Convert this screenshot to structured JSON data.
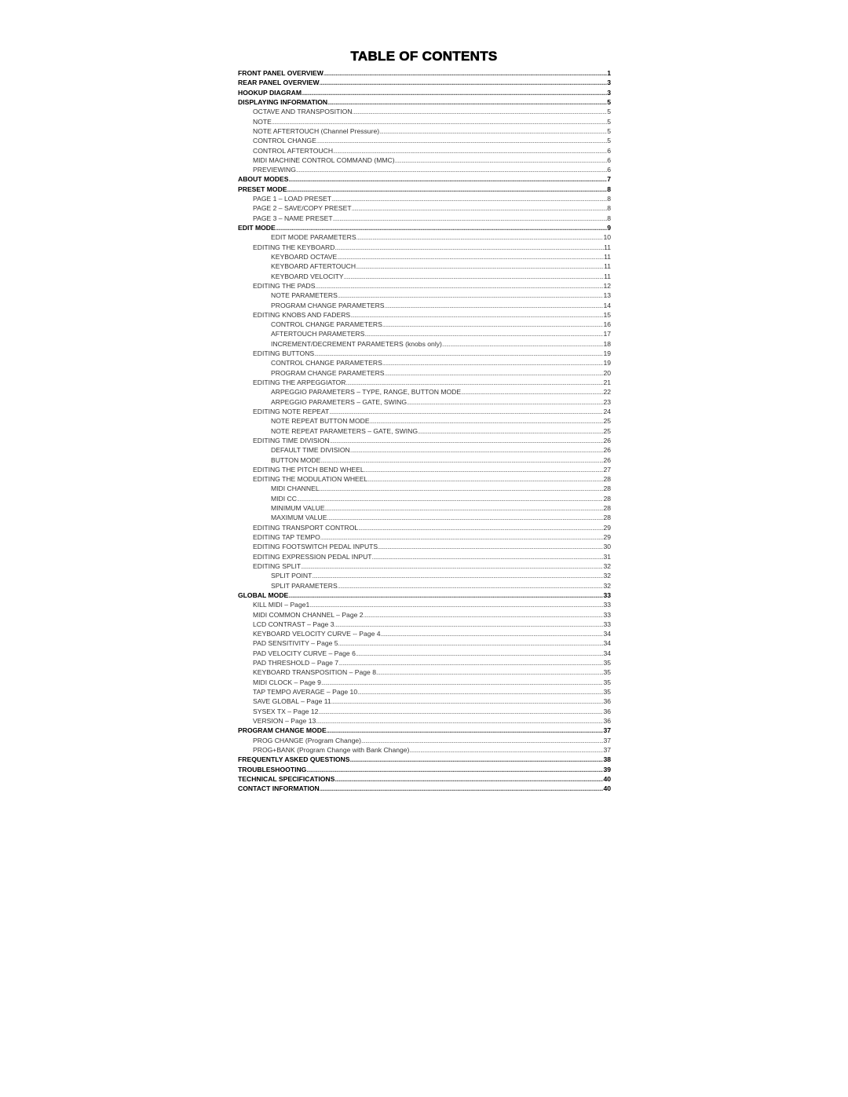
{
  "title": "TABLE OF CONTENTS",
  "entries": [
    {
      "label": "FRONT PANEL OVERVIEW",
      "page": "1",
      "level": 0
    },
    {
      "label": "REAR PANEL OVERVIEW",
      "page": "3",
      "level": 0
    },
    {
      "label": "HOOKUP DIAGRAM",
      "page": "3",
      "level": 0
    },
    {
      "label": "DISPLAYING INFORMATION",
      "page": "5",
      "level": 0
    },
    {
      "label": "OCTAVE AND TRANSPOSITION",
      "page": "5",
      "level": 1
    },
    {
      "label": "NOTE",
      "page": "5",
      "level": 1
    },
    {
      "label": "NOTE AFTERTOUCH (Channel Pressure)",
      "page": "5",
      "level": 1
    },
    {
      "label": "CONTROL CHANGE",
      "page": "5",
      "level": 1
    },
    {
      "label": "CONTROL AFTERTOUCH",
      "page": "6",
      "level": 1
    },
    {
      "label": "MIDI MACHINE CONTROL COMMAND (MMC)",
      "page": "6",
      "level": 1
    },
    {
      "label": "PREVIEWING",
      "page": "6",
      "level": 1
    },
    {
      "label": "ABOUT MODES",
      "page": "7",
      "level": 0
    },
    {
      "label": "PRESET MODE",
      "page": "8",
      "level": 0
    },
    {
      "label": "PAGE 1 – LOAD PRESET",
      "page": "8",
      "level": 1
    },
    {
      "label": "PAGE 2 – SAVE/COPY PRESET",
      "page": "8",
      "level": 1
    },
    {
      "label": "PAGE 3 – NAME PRESET",
      "page": "8",
      "level": 1
    },
    {
      "label": "EDIT MODE",
      "page": "9",
      "level": 0
    },
    {
      "label": "EDIT MODE PARAMETERS",
      "page": "10",
      "level": 2
    },
    {
      "label": "EDITING THE KEYBOARD",
      "page": "11",
      "level": 1
    },
    {
      "label": "KEYBOARD OCTAVE",
      "page": "11",
      "level": 2
    },
    {
      "label": "KEYBOARD AFTERTOUCH",
      "page": "11",
      "level": 2
    },
    {
      "label": "KEYBOARD VELOCITY",
      "page": "11",
      "level": 2
    },
    {
      "label": "EDITING THE PADS",
      "page": "12",
      "level": 1
    },
    {
      "label": "NOTE PARAMETERS",
      "page": "13",
      "level": 2
    },
    {
      "label": "PROGRAM CHANGE PARAMETERS",
      "page": "14",
      "level": 2
    },
    {
      "label": "EDITING KNOBS AND FADERS",
      "page": "15",
      "level": 1
    },
    {
      "label": "CONTROL CHANGE PARAMETERS",
      "page": "16",
      "level": 2
    },
    {
      "label": "AFTERTOUCH PARAMETERS",
      "page": "17",
      "level": 2
    },
    {
      "label": "INCREMENT/DECREMENT PARAMETERS (knobs only)",
      "page": "18",
      "level": 2
    },
    {
      "label": "EDITING BUTTONS",
      "page": "19",
      "level": 1
    },
    {
      "label": "CONTROL CHANGE PARAMETERS",
      "page": "19",
      "level": 2
    },
    {
      "label": "PROGRAM CHANGE PARAMETERS",
      "page": "20",
      "level": 2
    },
    {
      "label": "EDITING THE ARPEGGIATOR",
      "page": "21",
      "level": 1
    },
    {
      "label": "ARPEGGIO PARAMETERS – TYPE, RANGE, BUTTON MODE",
      "page": "22",
      "level": 2
    },
    {
      "label": "ARPEGGIO PARAMETERS – GATE, SWING",
      "page": "23",
      "level": 2
    },
    {
      "label": "EDITING NOTE REPEAT",
      "page": "24",
      "level": 1
    },
    {
      "label": "NOTE REPEAT BUTTON MODE",
      "page": "25",
      "level": 2
    },
    {
      "label": "NOTE REPEAT PARAMETERS – GATE, SWING",
      "page": "25",
      "level": 2
    },
    {
      "label": "EDITING TIME DIVISION",
      "page": "26",
      "level": 1
    },
    {
      "label": "DEFAULT TIME DIVISION",
      "page": "26",
      "level": 2
    },
    {
      "label": "BUTTON MODE",
      "page": "26",
      "level": 2
    },
    {
      "label": "EDITING THE PITCH BEND WHEEL",
      "page": "27",
      "level": 1
    },
    {
      "label": "EDITING THE MODULATION WHEEL",
      "page": "28",
      "level": 1
    },
    {
      "label": "MIDI CHANNEL",
      "page": "28",
      "level": 2
    },
    {
      "label": "MIDI CC",
      "page": "28",
      "level": 2
    },
    {
      "label": "MINIMUM VALUE",
      "page": "28",
      "level": 2
    },
    {
      "label": "MAXIMUM VALUE",
      "page": "28",
      "level": 2
    },
    {
      "label": "EDITING TRANSPORT CONTROL",
      "page": "29",
      "level": 1
    },
    {
      "label": "EDITING TAP TEMPO",
      "page": "29",
      "level": 1
    },
    {
      "label": "EDITING FOOTSWITCH PEDAL INPUTS",
      "page": "30",
      "level": 1
    },
    {
      "label": "EDITING EXPRESSION PEDAL INPUT",
      "page": "31",
      "level": 1
    },
    {
      "label": "EDITING SPLIT",
      "page": "32",
      "level": 1
    },
    {
      "label": "SPLIT POINT",
      "page": "32",
      "level": 2
    },
    {
      "label": "SPLIT PARAMETERS",
      "page": "32",
      "level": 2
    },
    {
      "label": "GLOBAL MODE",
      "page": "33",
      "level": 0
    },
    {
      "label": "KILL MIDI – Page1",
      "page": "33",
      "level": 1
    },
    {
      "label": "MIDI COMMON CHANNEL – Page 2",
      "page": "33",
      "level": 1
    },
    {
      "label": "LCD CONTRAST – Page 3",
      "page": "33",
      "level": 1
    },
    {
      "label": "KEYBOARD VELOCITY CURVE -- Page 4",
      "page": "34",
      "level": 1
    },
    {
      "label": "PAD SENSITIVITY – Page 5",
      "page": "34",
      "level": 1
    },
    {
      "label": "PAD VELOCITY CURVE – Page 6",
      "page": "34",
      "level": 1
    },
    {
      "label": "PAD THRESHOLD – Page 7",
      "page": "35",
      "level": 1
    },
    {
      "label": "KEYBOARD TRANSPOSITION – Page 8",
      "page": "35",
      "level": 1
    },
    {
      "label": "MIDI CLOCK – Page 9",
      "page": "35",
      "level": 1
    },
    {
      "label": "TAP TEMPO AVERAGE – Page 10",
      "page": "35",
      "level": 1
    },
    {
      "label": "SAVE GLOBAL – Page 11",
      "page": "36",
      "level": 1
    },
    {
      "label": "SYSEX TX – Page 12",
      "page": "36",
      "level": 1
    },
    {
      "label": "VERSION – Page 13",
      "page": "36",
      "level": 1
    },
    {
      "label": "PROGRAM CHANGE MODE",
      "page": "37",
      "level": 0
    },
    {
      "label": "PROG CHANGE (Program Change)",
      "page": "37",
      "level": 1
    },
    {
      "label": "PROG+BANK (Program Change with Bank Change)",
      "page": "37",
      "level": 1
    },
    {
      "label": "FREQUENTLY ASKED QUESTIONS",
      "page": "38",
      "level": 0
    },
    {
      "label": "TROUBLESHOOTING",
      "page": "39",
      "level": 0
    },
    {
      "label": "TECHNICAL SPECIFICATIONS",
      "page": "40",
      "level": 0
    },
    {
      "label": "CONTACT INFORMATION",
      "page": "40",
      "level": 0
    }
  ]
}
